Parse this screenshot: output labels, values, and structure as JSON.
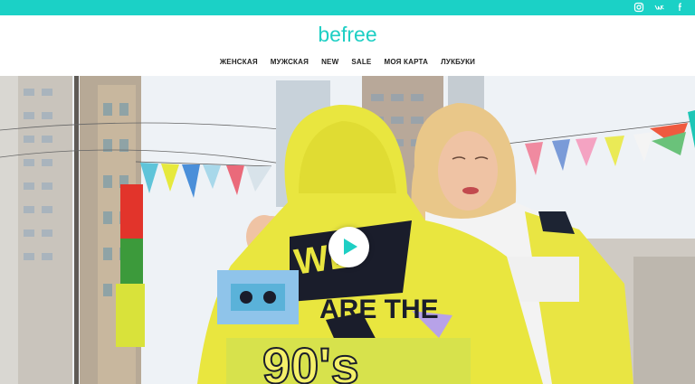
{
  "brand": {
    "logo_text": "befree",
    "accent": "#1bd1c6"
  },
  "social": [
    {
      "icon": "instagram-icon"
    },
    {
      "icon": "vk-icon"
    },
    {
      "icon": "facebook-icon"
    }
  ],
  "nav": {
    "items": [
      {
        "label": "ЖЕНСКАЯ"
      },
      {
        "label": "МУЖСКАЯ"
      },
      {
        "label": "NEW"
      },
      {
        "label": "SALE"
      },
      {
        "label": "МОЯ КАРТА"
      },
      {
        "label": "ЛУКБУКИ"
      }
    ]
  },
  "hero": {
    "print_lines": [
      "WE",
      "ARE THE",
      "90's"
    ],
    "video": {
      "icon": "play-icon"
    }
  }
}
